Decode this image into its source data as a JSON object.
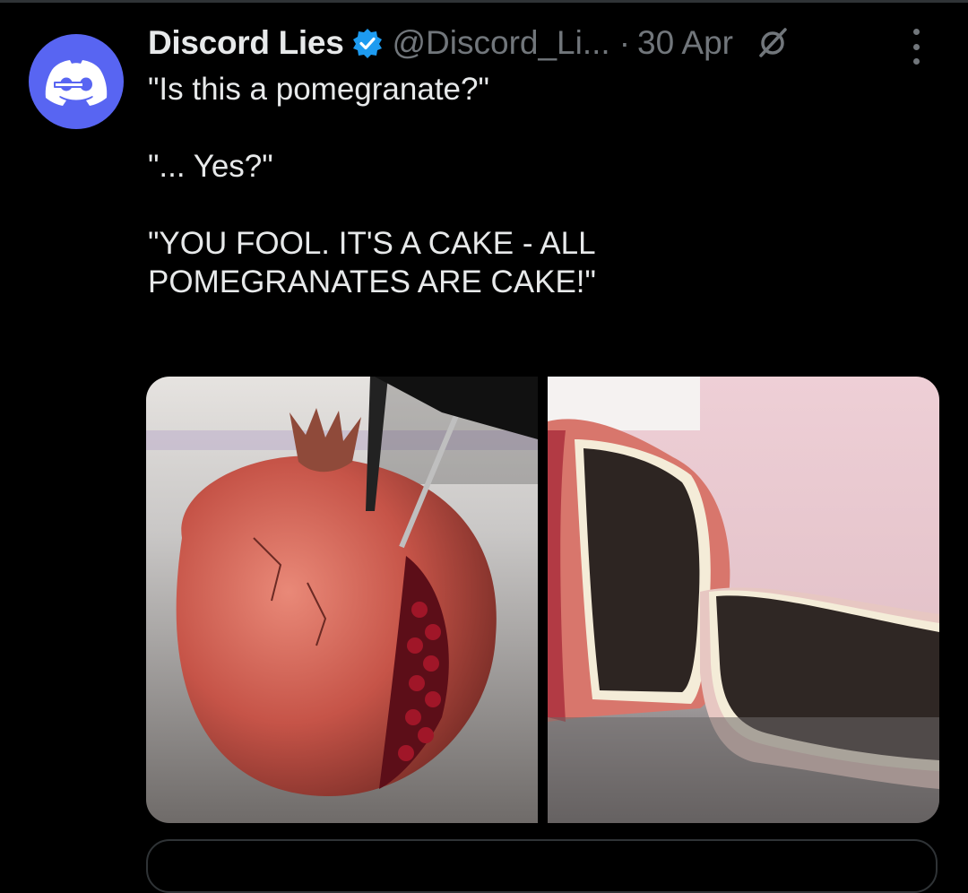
{
  "tweet": {
    "author_name": "Discord Lies",
    "handle": "@Discord_Li...",
    "separator": "·",
    "date": "30 Apr",
    "lines": [
      "\"Is this a pomegranate?\"",
      "\"... Yes?\"",
      "\"YOU FOOL. IT'S A CAKE - ALL POMEGRANATES ARE CAKE!\""
    ]
  },
  "icons": {
    "avatar": "discord-logo-icon",
    "verified": "verified-badge-icon",
    "grok": "grok-icon",
    "more": "more-options-icon"
  },
  "colors": {
    "background": "#000000",
    "text": "#e7e9ea",
    "muted": "#71767b",
    "verified": "#1d9bf0",
    "discord": "#5865f2"
  }
}
